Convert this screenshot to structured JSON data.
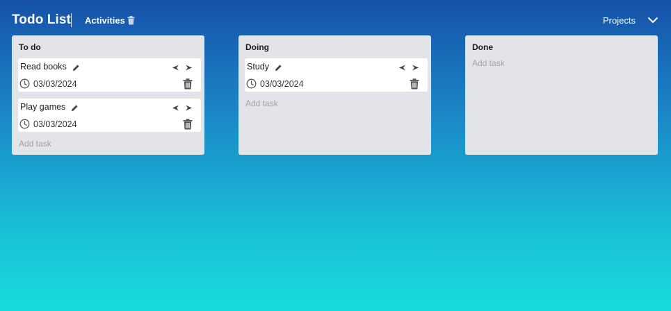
{
  "header": {
    "title": "Todo List",
    "board_name": "Activities",
    "projects_label": "Projects"
  },
  "columns": [
    {
      "title": "To do",
      "tasks": [
        {
          "name": "Read books",
          "date": "03/03/2024"
        },
        {
          "name": "Play games",
          "date": "03/03/2024"
        }
      ],
      "add_placeholder": "Add task"
    },
    {
      "title": "Doing",
      "tasks": [
        {
          "name": "Study",
          "date": "03/03/2024"
        }
      ],
      "add_placeholder": "Add task"
    },
    {
      "title": "Done",
      "tasks": [],
      "add_placeholder": "Add task"
    }
  ],
  "icons": {
    "board_delete": "trash-icon",
    "projects_toggle": "chevron-down-icon",
    "task_edit": "pencil-icon",
    "task_move_left": "arrow-left-icon",
    "task_move_right": "arrow-right-icon",
    "task_date": "clock-icon",
    "task_delete": "trash-icon"
  },
  "colors": {
    "gradient_top": "#1651a8",
    "gradient_bottom": "#17dcdd",
    "column_bg": "#e3e4e8",
    "card_bg": "#ffffff",
    "placeholder": "#a3a3a3"
  }
}
